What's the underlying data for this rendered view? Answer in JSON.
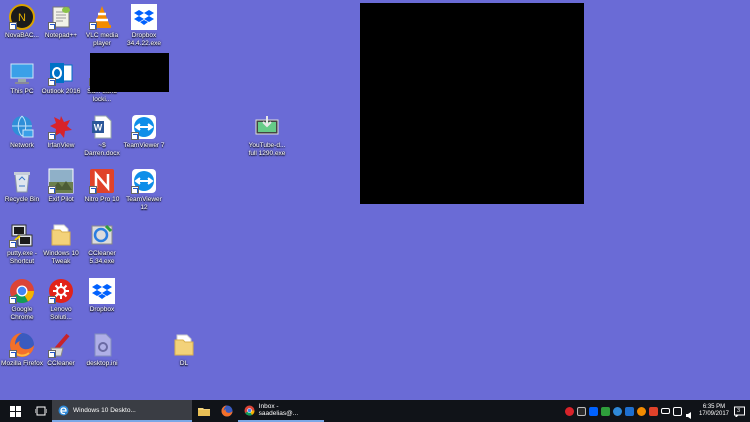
{
  "desktop": {
    "background": "#6a6bd6",
    "icons": [
      {
        "label": "NovaBAC...",
        "icon": "novabackup-icon"
      },
      {
        "label": "Notepad++",
        "icon": "notepad-plus-plus-icon"
      },
      {
        "label": "VLC media player",
        "icon": "vlc-icon"
      },
      {
        "label": "Dropbox 34.4.22.exe",
        "icon": "dropbox-icon"
      },
      {
        "label": "This PC",
        "icon": "this-pc-icon"
      },
      {
        "label": "Outlook 2016",
        "icon": "outlook-icon"
      },
      {
        "label": "Sa... band locki...",
        "icon": "shortcut-icon"
      },
      {
        "label": "Network",
        "icon": "network-icon"
      },
      {
        "label": "IrfanView",
        "icon": "irfanview-icon"
      },
      {
        "label": "~$ Darren.docx",
        "icon": "word-doc-icon"
      },
      {
        "label": "TeamViewer 7",
        "icon": "teamviewer-icon"
      },
      {
        "label": "YouTube-d... full 1290.exe",
        "icon": "youtube-dl-icon"
      },
      {
        "label": "Recycle Bin",
        "icon": "recycle-bin-icon"
      },
      {
        "label": "Exif Pilot",
        "icon": "exif-pilot-icon"
      },
      {
        "label": "Nitro Pro 10",
        "icon": "nitro-pro-icon"
      },
      {
        "label": "TeamViewer 12",
        "icon": "teamviewer-icon"
      },
      {
        "label": "putty.exe - Shortcut",
        "icon": "putty-icon"
      },
      {
        "label": "Windows 10 Tweak",
        "icon": "folder-icon"
      },
      {
        "label": "CCleaner 5.34.exe",
        "icon": "ccleaner-installer-icon"
      },
      {
        "label": "Google Chrome",
        "icon": "chrome-icon"
      },
      {
        "label": "Lenovo Soluti...",
        "icon": "lenovo-icon"
      },
      {
        "label": "Dropbox",
        "icon": "dropbox-icon"
      },
      {
        "label": "Mozilla Firefox",
        "icon": "firefox-icon"
      },
      {
        "label": "CCleaner",
        "icon": "ccleaner-icon"
      },
      {
        "label": "desktop.ini",
        "icon": "ini-file-icon"
      },
      {
        "label": "DL",
        "icon": "folder-icon"
      }
    ]
  },
  "taskbar": {
    "windows": [
      {
        "label": "Windows 10 Deskto...",
        "icon": "edge-icon",
        "state": "active"
      },
      {
        "label": "",
        "icon": "file-explorer-icon",
        "state": "pinned"
      },
      {
        "label": "",
        "icon": "firefox-icon",
        "state": "pinned"
      },
      {
        "label": "Inbox - saadelias@...",
        "icon": "chrome-icon",
        "state": "open"
      }
    ],
    "clock": {
      "time": "6:35 PM",
      "date": "17/09/2017"
    },
    "notification_count": "3"
  }
}
